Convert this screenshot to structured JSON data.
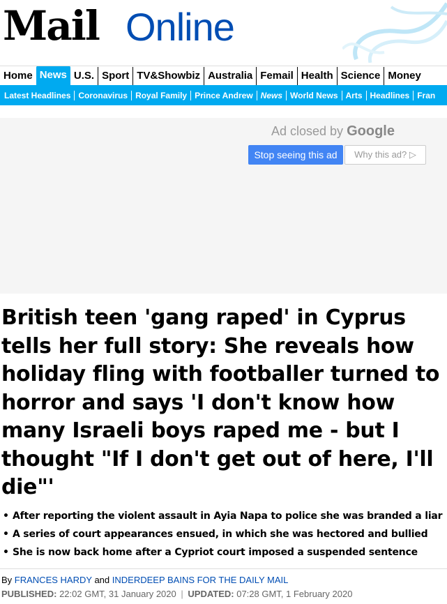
{
  "masthead": {
    "logo_mail": "Mail",
    "logo_online": "Online"
  },
  "nav": {
    "main": [
      "Home",
      "News",
      "U.S.",
      "Sport",
      "TV&Showbiz",
      "Australia",
      "Femail",
      "Health",
      "Science",
      "Money"
    ],
    "active": "News",
    "sub": [
      "Latest Headlines",
      "Coronavirus",
      "Royal Family",
      "Prince Andrew",
      "News",
      "World News",
      "Arts",
      "Headlines",
      "Fran"
    ]
  },
  "ad": {
    "closed_prefix": "Ad closed by",
    "closed_brand": "Google",
    "stop_label": "Stop seeing this ad",
    "why_label": "Why this ad?"
  },
  "article": {
    "headline": "British teen 'gang raped' in Cyprus tells her full story: She reveals how holiday fling with footballer turned to horror and says 'I don't know how many Israeli boys raped me - but I thought \"If I don't get out of here, I'll die\"'",
    "bullets": [
      "After reporting the violent assault in Ayia Napa to police she was branded a liar",
      "A series of court appearances ensued, in which she was hectored and bullied",
      "She is now back home after a Cypriot court imposed a suspended sentence"
    ],
    "byline_prefix": "By",
    "author1": "FRANCES HARDY",
    "byline_and": "and",
    "author2": "INDERDEEP BAINS FOR THE DAILY MAIL",
    "published_label": "PUBLISHED:",
    "published_value": "22:02 GMT, 31 January 2020",
    "updated_label": "UPDATED:",
    "updated_value": "07:28 GMT, 1 February 2020"
  },
  "colors": {
    "accent": "#00aaf0",
    "brand_blue": "#004db3",
    "google_blue": "#4285f4"
  }
}
